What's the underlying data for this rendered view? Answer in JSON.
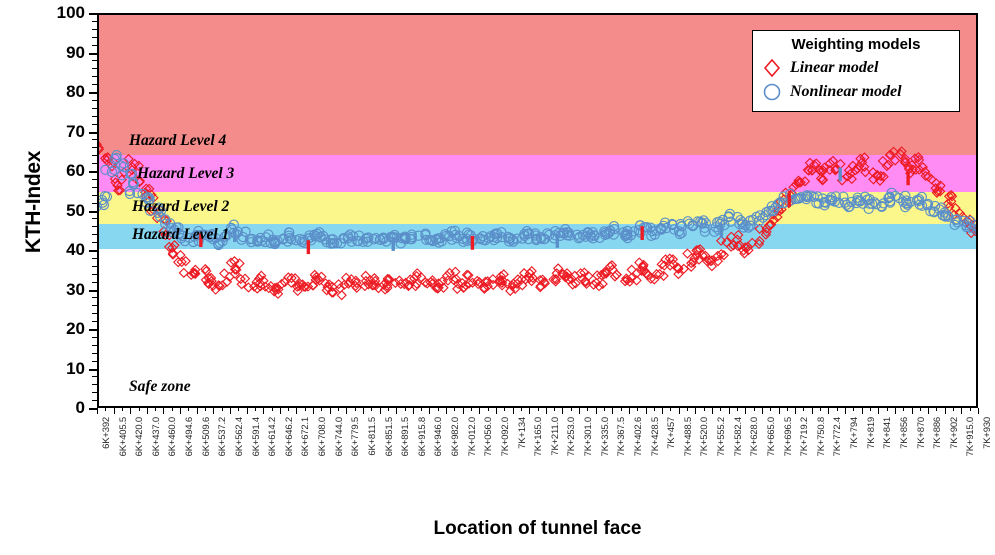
{
  "chart_data": {
    "type": "scatter",
    "title": "",
    "xlabel": "Location of tunnel face",
    "ylabel": "KTH-Index",
    "ylim": [
      0,
      100
    ],
    "ytick_step": 10,
    "yticks": [
      0,
      10,
      20,
      30,
      40,
      50,
      60,
      70,
      80,
      90,
      100
    ],
    "grid": false,
    "legend_position": "top-right",
    "legend_title": "Weighting models",
    "series": [
      {
        "name": "Linear model",
        "marker": "diamond",
        "color": "#ed1c24",
        "values": [
          66.5,
          64.2,
          62.0,
          57.5,
          56.0,
          60.5,
          62.3,
          58.0,
          55.2,
          53.5,
          50.0,
          47.5,
          44.2,
          41.0,
          38.5,
          36.2,
          34.0,
          33.5,
          35.0,
          33.0,
          31.5,
          30.5,
          31.0,
          33.8,
          36.5,
          34.5,
          32.0,
          30.8,
          31.5,
          32.6,
          30.2,
          29.5,
          30.0,
          31.2,
          32.8,
          31.0,
          29.8,
          30.5,
          31.8,
          33.0,
          31.5,
          30.0,
          29.2,
          30.8,
          32.0,
          31.2,
          30.4,
          31.6,
          32.5,
          31.0,
          30.2,
          31.4,
          32.6,
          31.8,
          30.5,
          31.2,
          32.0,
          33.2,
          31.5,
          30.8,
          31.0,
          32.2,
          33.5,
          32.0,
          30.6,
          31.4,
          32.8,
          31.2,
          30.0,
          31.5,
          32.4,
          33.0,
          31.6,
          30.2,
          31.0,
          32.5,
          33.8,
          32.2,
          30.8,
          31.5,
          32.0,
          33.2,
          34.5,
          33.0,
          31.8,
          32.5,
          33.5,
          32.0,
          31.2,
          32.8,
          34.0,
          35.2,
          33.5,
          32.0,
          33.0,
          34.5,
          36.0,
          34.8,
          33.2,
          34.0,
          35.5,
          37.0,
          35.8,
          34.5,
          36.0,
          38.5,
          40.0,
          38.2,
          36.5,
          37.5,
          39.0,
          41.5,
          43.0,
          41.2,
          39.5,
          40.5,
          42.0,
          44.5,
          46.0,
          48.2,
          50.5,
          52.0,
          54.5,
          56.8,
          58.0,
          60.5,
          62.0,
          59.5,
          57.8,
          60.2,
          62.5,
          61.0,
          58.5,
          59.8,
          61.5,
          63.0,
          60.5,
          58.2,
          59.5,
          61.8,
          63.5,
          64.8,
          62.5,
          60.0,
          61.2,
          62.8,
          60.5,
          58.0,
          56.5,
          55.0,
          53.2,
          51.5,
          49.8,
          48.0,
          46.5,
          45.0
        ]
      },
      {
        "name": "Nonlinear model",
        "marker": "circle",
        "color": "#5b8fc9",
        "values": [
          51.5,
          53.0,
          60.5,
          63.5,
          62.0,
          58.5,
          55.0,
          56.5,
          54.0,
          52.5,
          50.8,
          49.0,
          47.5,
          46.0,
          44.5,
          43.2,
          42.5,
          43.0,
          44.2,
          43.5,
          42.8,
          42.0,
          42.5,
          44.0,
          45.5,
          43.8,
          42.5,
          42.0,
          42.8,
          43.5,
          42.2,
          41.8,
          42.0,
          42.6,
          43.8,
          42.5,
          42.0,
          42.4,
          43.2,
          44.0,
          42.8,
          42.2,
          41.8,
          42.5,
          43.0,
          42.6,
          42.2,
          42.8,
          43.5,
          42.8,
          42.2,
          42.6,
          43.2,
          42.8,
          42.3,
          42.6,
          43.0,
          43.8,
          42.8,
          42.4,
          42.6,
          43.2,
          44.0,
          43.0,
          42.4,
          42.8,
          43.5,
          42.8,
          42.2,
          42.8,
          43.2,
          43.8,
          43.0,
          42.4,
          42.8,
          43.5,
          44.2,
          43.5,
          42.8,
          43.0,
          43.5,
          44.0,
          45.0,
          44.2,
          43.5,
          43.8,
          44.5,
          43.8,
          43.2,
          44.0,
          44.8,
          45.5,
          44.5,
          43.8,
          44.2,
          45.0,
          46.0,
          45.2,
          44.2,
          44.8,
          45.5,
          46.5,
          45.8,
          44.8,
          45.5,
          46.8,
          47.5,
          46.5,
          45.2,
          45.8,
          46.5,
          47.8,
          48.5,
          47.2,
          46.0,
          46.5,
          47.5,
          48.8,
          49.5,
          50.5,
          51.2,
          52.0,
          52.8,
          53.5,
          52.8,
          53.2,
          54.0,
          52.5,
          51.8,
          52.5,
          53.5,
          52.8,
          51.5,
          52.0,
          52.8,
          53.5,
          52.2,
          51.0,
          51.8,
          52.5,
          53.2,
          54.0,
          53.0,
          51.5,
          52.2,
          53.0,
          51.8,
          50.5,
          50.0,
          49.2,
          48.5,
          48.0,
          47.2,
          46.5,
          46.0,
          45.5
        ]
      }
    ],
    "hazard_bands": [
      {
        "name": "Hazard Level 4",
        "min": 64.6,
        "max": 100.0,
        "color": "#f58c8c"
      },
      {
        "name": "Hazard Level 3",
        "min": 55.2,
        "max": 64.6,
        "color": "#ff8cf5"
      },
      {
        "name": "Hazard Level 2",
        "min": 47.1,
        "max": 55.2,
        "color": "#fbf78a"
      },
      {
        "name": "Hazard Level 1",
        "min": 40.8,
        "max": 47.1,
        "color": "#87d7f0"
      },
      {
        "name": "Safe zone",
        "min": 0.0,
        "max": 40.8,
        "color": "#ffffff"
      }
    ],
    "xticklabels": [
      "6K+392",
      "6K+405.5",
      "6K+420.0",
      "6K+437.0",
      "6K+460.0",
      "6K+494.6",
      "6K+509.6",
      "6K+537.2",
      "6K+562.4",
      "6K+591.4",
      "6K+614.2",
      "6K+646.2",
      "6K+672.1",
      "6K+708.0",
      "6K+744.0",
      "6K+779.5",
      "6K+811.5",
      "6K+851.5",
      "6K+891.5",
      "6K+915.8",
      "6K+946.0",
      "6K+982.0",
      "7K+012.0",
      "7K+056.0",
      "7K+092.0",
      "7K+134",
      "7K+165.0",
      "7K+211.0",
      "7K+253.0",
      "7K+301.0",
      "7K+335.0",
      "7K+367.5",
      "7K+402.6",
      "7K+428.5",
      "7K+457",
      "7K+488.5",
      "7K+520.0",
      "7K+555.2",
      "7K+582.4",
      "7K+628.0",
      "7K+665.0",
      "7K+696.5",
      "7K+719.2",
      "7K+750.8",
      "7K+772.4",
      "7K+794",
      "7K+819",
      "7K+841",
      "7K+856",
      "7K+870",
      "7K+886",
      "7K+902",
      "7K+915.0",
      "7K+930"
    ]
  },
  "legend": {
    "title": "Weighting models",
    "entries": [
      {
        "label": "Linear model",
        "marker": "diamond-icon",
        "color": "#ed1c24"
      },
      {
        "label": "Nonlinear model",
        "marker": "circle-icon",
        "color": "#5b8fc9"
      }
    ]
  }
}
